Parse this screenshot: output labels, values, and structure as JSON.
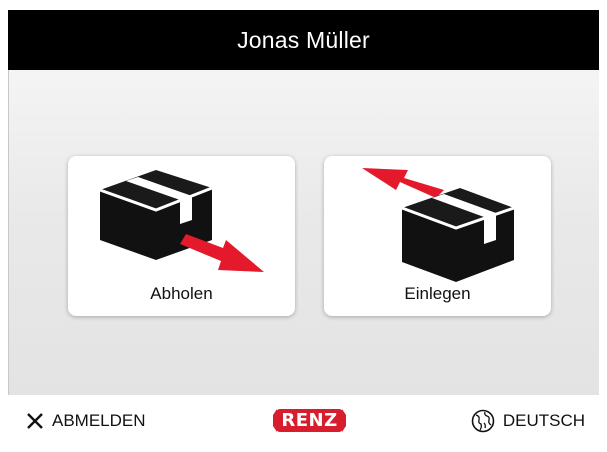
{
  "header": {
    "user_name": "Jonas Müller"
  },
  "tiles": [
    {
      "label": "Abholen",
      "icon": "box-arrow-out-icon"
    },
    {
      "label": "Einlegen",
      "icon": "box-arrow-in-icon"
    }
  ],
  "footer": {
    "logout_label": "ABMELDEN",
    "language_label": "DEUTSCH",
    "logo_text": "RENZ"
  },
  "colors": {
    "header_bg": "#000000",
    "accent_red": "#e4192c",
    "logo_red": "#d81d2c"
  }
}
